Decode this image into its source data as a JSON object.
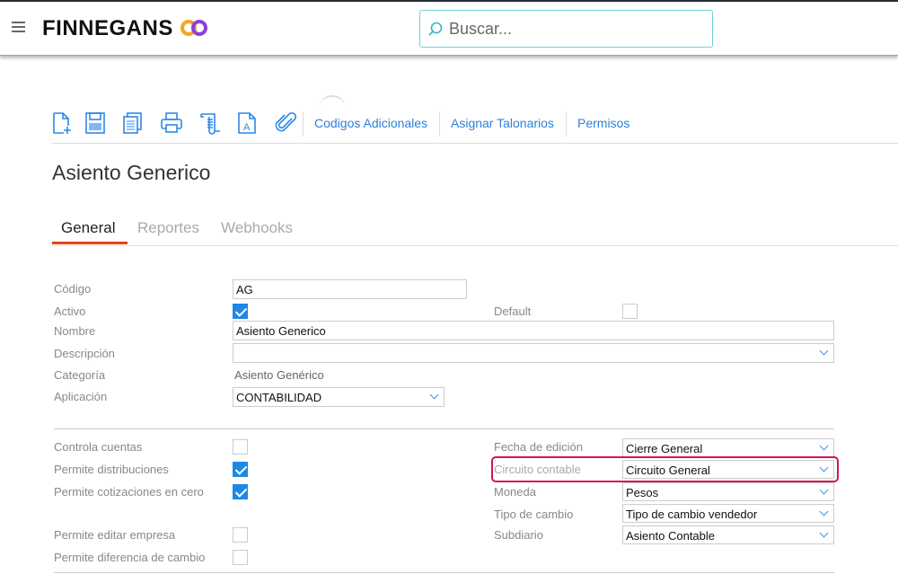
{
  "header": {
    "brand": "FINNEGANS",
    "search_placeholder": "Buscar..."
  },
  "toolbar": {
    "links": [
      "Codigos Adicionales",
      "Asignar Talonarios",
      "Permisos"
    ]
  },
  "page_title": "Asiento Generico",
  "tabs": [
    "General",
    "Reportes",
    "Webhooks"
  ],
  "form": {
    "codigo": {
      "label": "Código",
      "value": "AG"
    },
    "activo": {
      "label": "Activo",
      "checked": true
    },
    "default": {
      "label": "Default",
      "checked": false
    },
    "nombre": {
      "label": "Nombre",
      "value": "Asiento Generico"
    },
    "descripcion": {
      "label": "Descripción",
      "value": ""
    },
    "categoria": {
      "label": "Categoría",
      "value": "Asiento Genérico"
    },
    "aplicacion": {
      "label": "Aplicación",
      "value": "CONTABILIDAD"
    },
    "controla_cuentas": {
      "label": "Controla cuentas",
      "checked": false
    },
    "permite_distribuciones": {
      "label": "Permite distribuciones",
      "checked": true
    },
    "permite_cotizaciones": {
      "label": "Permite cotizaciones en cero",
      "checked": true
    },
    "permite_editar_empresa": {
      "label": "Permite editar empresa",
      "checked": false
    },
    "permite_diferencia": {
      "label": "Permite diferencia de cambio",
      "checked": false
    },
    "fecha_edicion": {
      "label": "Fecha de edición",
      "value": "Cierre General"
    },
    "circuito": {
      "label": "Circuito contable",
      "value": "Circuito General"
    },
    "moneda": {
      "label": "Moneda",
      "value": "Pesos"
    },
    "tipo_cambio": {
      "label": "Tipo de cambio",
      "value": "Tipo de cambio vendedor"
    },
    "subdiario": {
      "label": "Subdiario",
      "value": "Asiento Contable"
    }
  },
  "colors": {
    "accent": "#2f87e8",
    "tab_underline": "#e8401c",
    "highlight": "#d0145f"
  }
}
